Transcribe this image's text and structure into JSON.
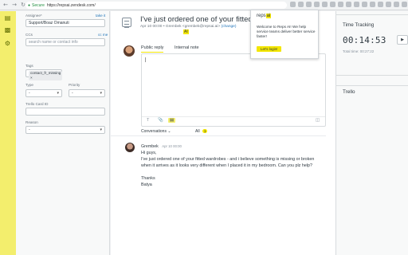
{
  "browser": {
    "secure_label": "Secure",
    "url": "https://repsai.zendesk.com/"
  },
  "properties": {
    "assignee_label": "Assignee*",
    "take_it": "take it",
    "assignee_value": "Support/Boaz Omanuti",
    "ccs_label": "CCs",
    "cc_me": "cc me",
    "cc_placeholder": "search name or contact info",
    "tags_label": "Tags",
    "tag_value": "contact_fr_missing ×",
    "type_label": "Type",
    "type_value": "-",
    "priority_label": "Priority",
    "priority_value": "-",
    "trello_label": "Trello Card ID",
    "reason_label": "Reason",
    "reason_value": "-"
  },
  "ticket": {
    "subject": "I've just ordered one of your fitted wardrobes",
    "meta_date": "Apr 10 00:00",
    "meta_author": "Grembek <grembek@repsai.ai>",
    "meta_via": "(change)"
  },
  "composer": {
    "tab_public": "Public reply",
    "tab_internal": "Internal note",
    "ai_label": "AI"
  },
  "conversation": {
    "filter_label": "Conversations ⌄",
    "all_label": "All",
    "all_count": "1",
    "author": "Grembek",
    "time": "Apr 10 00:00",
    "lines": [
      "Hi guys,",
      "I've just ordered one of your fitted wardrobes - and i believe something is missing or broken",
      "when it arrives as it looks very different when I placed it in my bedroom. Can you plz help?",
      "",
      "Thanks",
      "Batya"
    ]
  },
  "right_panel": {
    "time_tracking": "Time Tracking",
    "timer": "00:14:53",
    "total_time": "Total time:  00:27:22",
    "trello": "Trello"
  },
  "popup": {
    "brand": "reps",
    "brand_ai": "ai",
    "description": "Welcome to Reps AI! We help service teams deliver better service faster!",
    "cta": "Let's login!"
  },
  "colors": {
    "accent_yellow": "#f3e600",
    "sidebar_yellow": "#f3ee6d",
    "link_blue": "#1f73b7"
  }
}
